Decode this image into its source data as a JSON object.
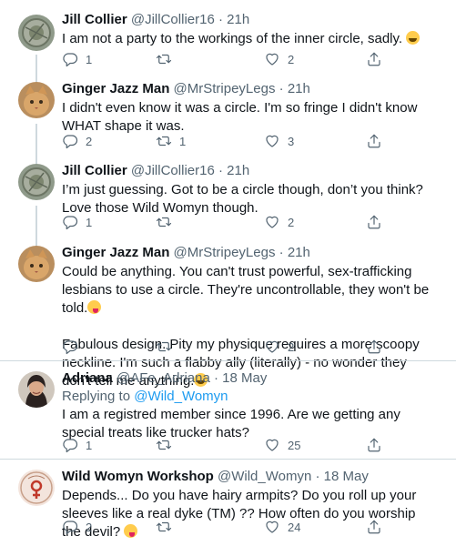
{
  "tweets": [
    {
      "name": "Jill Collier",
      "handle": "@JillCollier16",
      "time": "21h",
      "text": [
        "I am not a party to the workings of the inner circle, sadly."
      ],
      "reply_count": "1",
      "retweet_count": "",
      "like_count": "2"
    },
    {
      "name": "Ginger Jazz Man",
      "handle": "@MrStripeyLegs",
      "time": "21h",
      "text": [
        "I didn't even know it was a circle. I'm so fringe I didn't know WHAT shape it was."
      ],
      "reply_count": "2",
      "retweet_count": "1",
      "like_count": "3"
    },
    {
      "name": "Jill Collier",
      "handle": "@JillCollier16",
      "time": "21h",
      "text": [
        "I’m just guessing. Got to be a circle though, don’t you think? Love those Wild Womyn though."
      ],
      "reply_count": "1",
      "retweet_count": "",
      "like_count": "2"
    },
    {
      "name": "Ginger Jazz Man",
      "handle": "@MrStripeyLegs",
      "time": "21h",
      "text": [
        "Could be anything. You can't trust powerful, sex-trafficking lesbians to use a circle. They're uncontrollable, they won't be told.",
        "Fabulous design. Pity my physique requires a more scoopy neckline. I'm such a flabby ally (literally) - no wonder they don't tell me anything."
      ],
      "reply_count": "",
      "retweet_count": "",
      "like_count": "2"
    },
    {
      "name": "Adriana",
      "handle": "@AFe_Adriana",
      "time": "18 May",
      "replying_prefix": "Replying to",
      "replying_handle": "@Wild_Womyn",
      "text": [
        "I am a registred member since 1996. Are we getting any special treats like trucker hats?"
      ],
      "reply_count": "1",
      "retweet_count": "",
      "like_count": "25"
    },
    {
      "name": "Wild Womyn Workshop",
      "handle": "@Wild_Womyn",
      "time": "18 May",
      "text": [
        "Depends... Do you have hairy armpits? Do you roll up your sleeves like a real dyke (TM) ?? How often do you worship the devil?"
      ],
      "reply_count": "2",
      "retweet_count": "",
      "like_count": "24"
    }
  ],
  "emojis": {
    "tweet1": "face-with-tears-of-joy",
    "tweet4a": "winking-face-with-tongue",
    "tweet4b": "face-with-tears-of-joy",
    "tweet6": "winking-face-with-tongue"
  },
  "colors": {
    "text": "#0f1419",
    "secondary": "#536471",
    "link": "#1d9bf0",
    "divider": "#cfd9de"
  }
}
